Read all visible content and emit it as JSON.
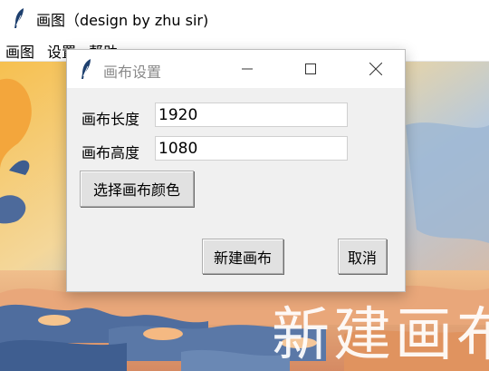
{
  "window": {
    "title": "画图（design by zhu sir)",
    "icon": "feather-icon"
  },
  "menubar": {
    "items": [
      "画图",
      "设置",
      "帮助"
    ]
  },
  "canvas": {
    "watermark_text": "新建画布"
  },
  "dialog": {
    "title": "画布设置",
    "icon": "feather-icon",
    "width_label": "画布长度",
    "width_value": "1920",
    "height_label": "画布高度",
    "height_value": "1080",
    "color_button": "选择画布颜色",
    "confirm_button": "新建画布",
    "cancel_button": "取消"
  },
  "colors": {
    "dialog_bg": "#f0f0f0",
    "button_bg": "#e1e1e1",
    "sky_orange": "#f2b24a",
    "sky_blue": "#8fb2d6",
    "cloud_blue": "#4d6a9b"
  }
}
